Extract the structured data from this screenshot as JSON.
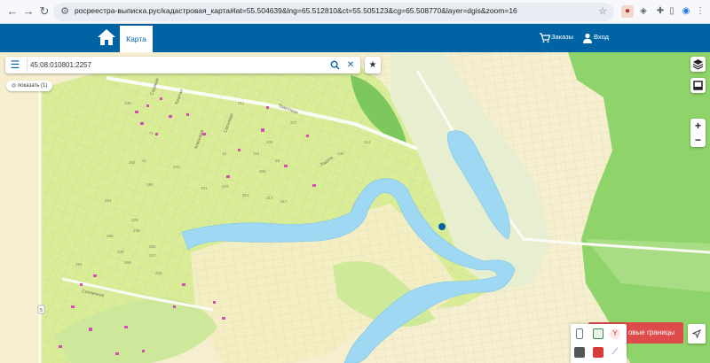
{
  "browser": {
    "url": "росреестра-выписка.рус/кадастровая_карта#lat=55.504639&lng=65.512810&ct=55.505123&cg=65.508770&layer=dgis&zoom=16",
    "back_icon": "arrow-left-icon",
    "forward_icon": "arrow-right-icon",
    "reload_icon": "reload-icon"
  },
  "header": {
    "tab_map": "Карта",
    "orders": "Заказы",
    "login": "Вход"
  },
  "search": {
    "value": "45:08:010801:2257"
  },
  "show_button": "показать (1)",
  "bottom_panel": {
    "border_label": "овые границы"
  },
  "map_labels": {
    "streets": [
      "Садовая",
      "Каштан",
      "Трактовая",
      "Кленовая",
      "Сосновая",
      "Солнечная",
      "Ладога"
    ],
    "parcel_numbers": [
      "236",
      "211",
      "227",
      "255",
      "203",
      "112",
      "106",
      "130",
      "114",
      "219",
      "196",
      "201",
      "306",
      "217",
      "317",
      "313",
      "281",
      "248",
      "247",
      "265",
      "254",
      "238",
      "256",
      "268",
      "225",
      "283",
      "31",
      "71",
      "12",
      "28"
    ],
    "route_number": "5"
  },
  "colors": {
    "header_blue": "#0064a4",
    "water": "#9fd8f2",
    "forest": "#8fd46a",
    "meadow": "#d8ecA0",
    "parcel_mark": "#d24fb2",
    "border_button": "#de4b4b"
  }
}
